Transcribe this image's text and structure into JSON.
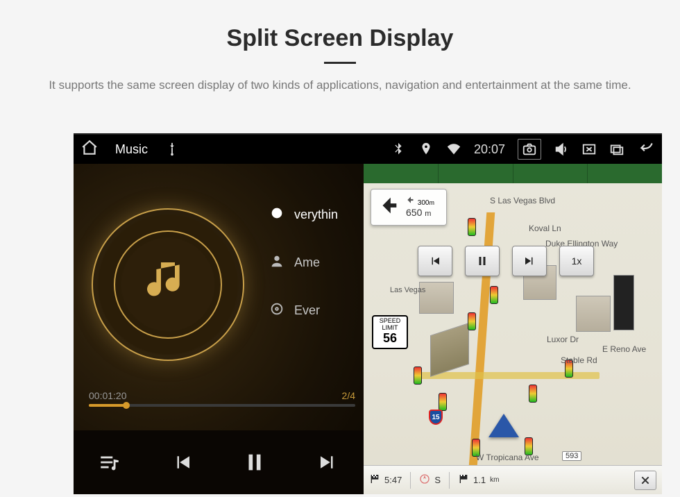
{
  "header": {
    "title": "Split Screen Display",
    "subtitle": "It supports the same screen display of two kinds of applications, navigation and entertainment at the same time."
  },
  "statusbar": {
    "app_label": "Music",
    "time": "20:07"
  },
  "music": {
    "tracks": [
      {
        "label": "verythin"
      },
      {
        "label": "Ame"
      },
      {
        "label": "Ever"
      }
    ],
    "elapsed": "00:01:20",
    "counter": "2/4"
  },
  "nav": {
    "next_turn_dist": "650",
    "next_turn_unit": "m",
    "sub_dist": "300",
    "sub_unit": "m",
    "speed_label1": "SPEED",
    "speed_label2": "LIMIT",
    "speed_value": "56",
    "speed_btn": "1x",
    "roads": {
      "r1": "S Las Vegas Blvd",
      "r2": "Koval Ln",
      "r3": "Duke Ellington Way",
      "r4": "Luxor Dr",
      "r5": "Stable Rd",
      "r6": "E Reno Ave",
      "r7": "W Tropicana Ave",
      "r8": "Las Vegas",
      "tag": "593"
    },
    "shield": "15",
    "bottom": {
      "eta": "5:47",
      "compass": "S",
      "distance": "1.1",
      "distance_unit": "km"
    }
  }
}
